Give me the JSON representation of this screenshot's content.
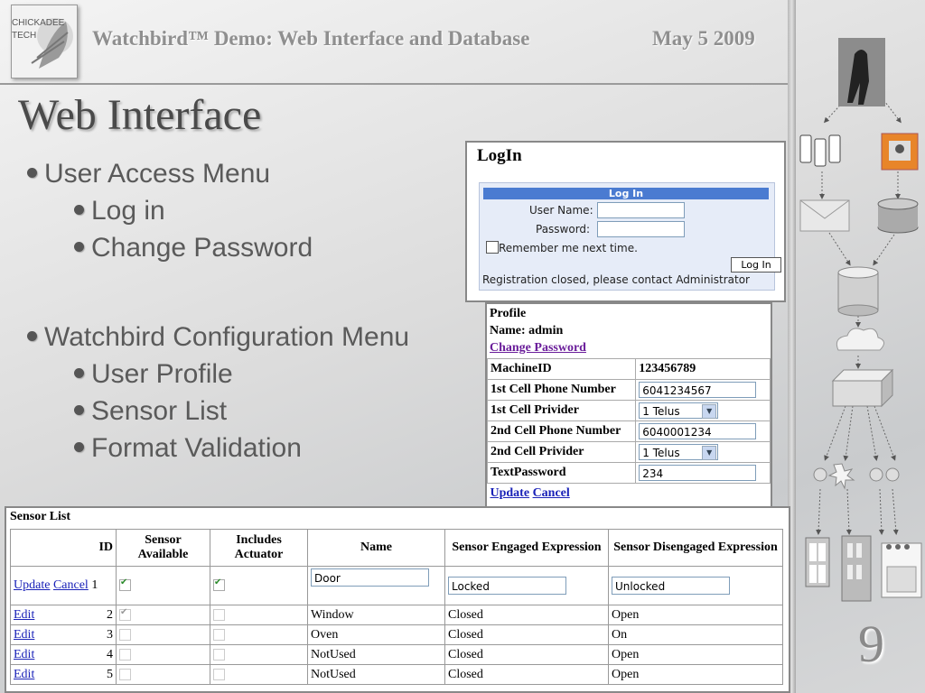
{
  "header": {
    "logo_line1": "CHICKADEE",
    "logo_line2": "TECH",
    "title": "Watchbird™ Demo: Web Interface and Database",
    "date": "May 5 2009"
  },
  "slide": {
    "title": "Web Interface",
    "number": "9",
    "bullets": [
      {
        "text": "User Access Menu",
        "sub": [
          "Log in",
          "Change Password"
        ]
      },
      {
        "text": "Watchbird Configuration Menu",
        "sub": [
          "User Profile",
          "Sensor List",
          "Format Validation"
        ]
      }
    ]
  },
  "login": {
    "title": "LogIn",
    "box_header": "Log In",
    "username_label": "User Name:",
    "password_label": "Password:",
    "remember_label": "Remember me next time.",
    "button": "Log In",
    "note": "Registration closed, please contact Administrator"
  },
  "profile": {
    "title": "Profile",
    "name_line": "Name: admin",
    "change_password": "Change Password",
    "rows": [
      {
        "label": "MachineID",
        "value": "123456789",
        "kind": "text"
      },
      {
        "label": "1st Cell Phone Number",
        "value": "6041234567",
        "kind": "input"
      },
      {
        "label": "1st Cell Privider",
        "value": "1 Telus",
        "kind": "select"
      },
      {
        "label": "2nd Cell Phone Number",
        "value": "6040001234",
        "kind": "input"
      },
      {
        "label": "2nd Cell Privider",
        "value": "1 Telus",
        "kind": "select"
      },
      {
        "label": "TextPassword",
        "value": "234",
        "kind": "input"
      }
    ],
    "update": "Update",
    "cancel": "Cancel"
  },
  "sensor_list": {
    "title": "Sensor List",
    "headers": [
      "ID",
      "Sensor Available",
      "Includes Actuator",
      "Name",
      "Sensor Engaged Expression",
      "Sensor Disengaged Expression"
    ],
    "edit_row": {
      "update": "Update",
      "cancel": "Cancel",
      "id": "1",
      "available": true,
      "actuator": true,
      "name": "Door",
      "engaged": "Locked",
      "disengaged": "Unlocked"
    },
    "rows": [
      {
        "action": "Edit",
        "id": "2",
        "available": true,
        "actuator": false,
        "name": "Window",
        "engaged": "Closed",
        "disengaged": "Open"
      },
      {
        "action": "Edit",
        "id": "3",
        "available": false,
        "actuator": false,
        "name": "Oven",
        "engaged": "Closed",
        "disengaged": "On"
      },
      {
        "action": "Edit",
        "id": "4",
        "available": false,
        "actuator": false,
        "name": "NotUsed",
        "engaged": "Closed",
        "disengaged": "Open"
      },
      {
        "action": "Edit",
        "id": "5",
        "available": false,
        "actuator": false,
        "name": "NotUsed",
        "engaged": "Closed",
        "disengaged": "Open"
      }
    ]
  },
  "diagram": {
    "icons": [
      "person-photo-icon",
      "phones-icon",
      "computer-icon",
      "email-icon",
      "database-icon",
      "server-icon",
      "cloud-icon",
      "hub-icon",
      "sensor-icon",
      "window-icon",
      "fridge-icon",
      "stove-icon"
    ]
  }
}
